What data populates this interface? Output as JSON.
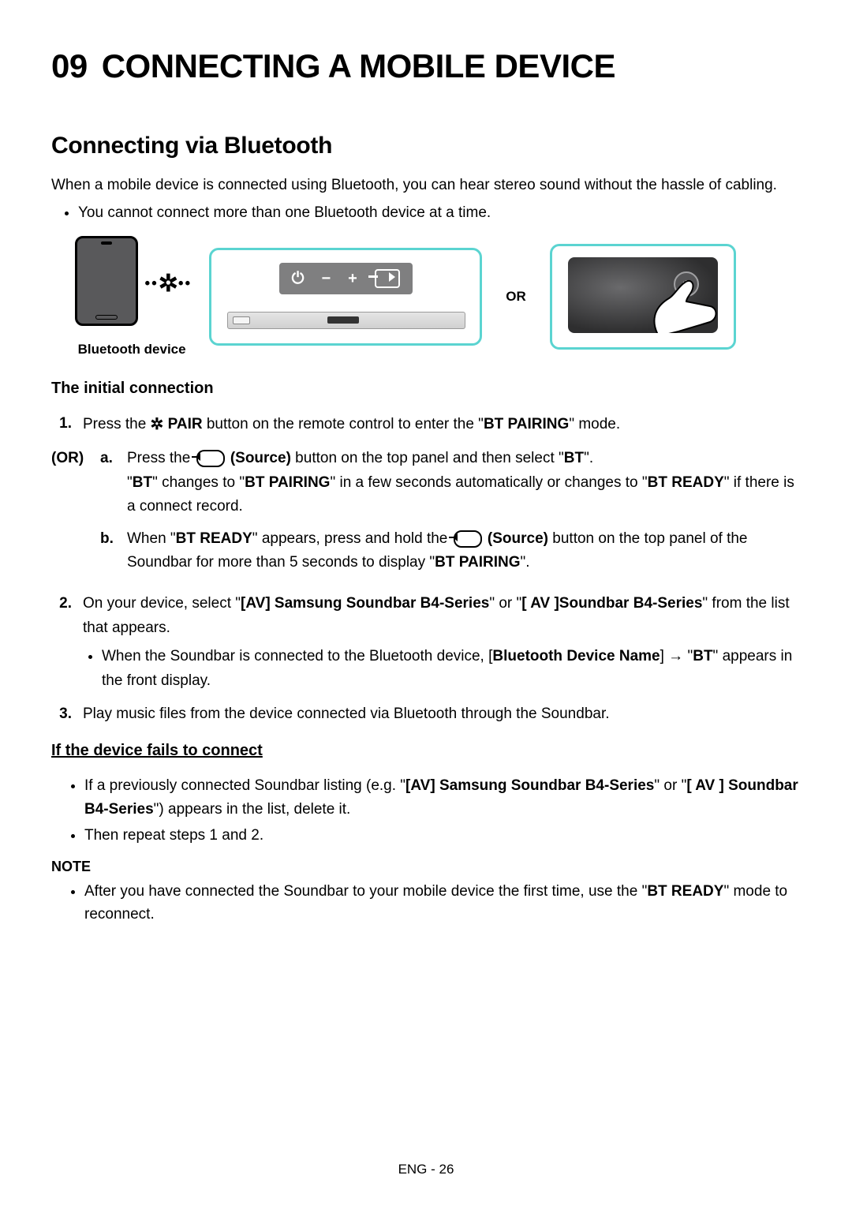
{
  "chapter": {
    "number": "09",
    "title": "CONNECTING A MOBILE DEVICE"
  },
  "section": {
    "title": "Connecting via Bluetooth"
  },
  "intro": "When a mobile device is connected using Bluetooth, you can hear stereo sound without the hassle of cabling.",
  "intro_bullet": "You cannot connect more than one Bluetooth device at a time.",
  "diagram": {
    "device_caption": "Bluetooth device",
    "or_label": "OR",
    "panel_buttons": {
      "power": "⏻",
      "minus": "−",
      "plus": "+",
      "source": "source"
    }
  },
  "initial": {
    "heading": "The initial connection",
    "step1": {
      "num": "1.",
      "pre": "Press the ",
      "pair_label": " PAIR",
      "post1": " button on the remote control to enter the \"",
      "bt_pairing": "BT PAIRING",
      "post2": "\" mode."
    },
    "or_label": "(OR)",
    "step_a": {
      "letter": "a.",
      "pre": "Press the ",
      "source_label": " (Source)",
      "mid": " button on the top panel and then select \"",
      "bt": "BT",
      "post": "\".",
      "line2_pre": "\"",
      "line2_bt": "BT",
      "line2_mid1": "\" changes to \"",
      "line2_btp": "BT PAIRING",
      "line2_mid2": "\" in a few seconds automatically or changes to \"",
      "line2_btr": "BT READY",
      "line2_post": "\" if there is a connect record."
    },
    "step_b": {
      "letter": "b.",
      "pre": "When \"",
      "btr": "BT READY",
      "mid1": "\" appears, press and hold the ",
      "source_label": " (Source)",
      "mid2": " button on the top panel of the Soundbar for more than 5 seconds to display \"",
      "btp": "BT PAIRING",
      "post": "\"."
    },
    "step2": {
      "num": "2.",
      "pre": "On your device, select \"",
      "name1": "[AV] Samsung Soundbar B4-Series",
      "mid": "\" or \"",
      "name2": "[ AV ]Soundbar B4-Series",
      "post": "\" from the list that appears.",
      "bullet_pre": "When the Soundbar is connected to the Bluetooth device, [",
      "bullet_bold": "Bluetooth Device Name",
      "bullet_mid": "] → \"",
      "bullet_bt": "BT",
      "bullet_post": "\" appears in the front display."
    },
    "step3": {
      "num": "3.",
      "text": "Play music files from the device connected via Bluetooth through the Soundbar."
    }
  },
  "fail": {
    "heading": "If the device fails to connect",
    "bullet1_pre": "If a previously connected Soundbar listing (e.g. \"",
    "bullet1_b1": "[AV] Samsung Soundbar B4-Series",
    "bullet1_mid": "\" or \"",
    "bullet1_b2": "[ AV ] Soundbar B4-Series",
    "bullet1_post": "\") appears in the list, delete it.",
    "bullet2": "Then repeat steps 1 and 2."
  },
  "note": {
    "heading": "NOTE",
    "bullet_pre": "After you have connected the Soundbar to your mobile device the first time, use the \"",
    "bullet_bold": "BT READY",
    "bullet_post": "\" mode to reconnect."
  },
  "footer": "ENG - 26"
}
